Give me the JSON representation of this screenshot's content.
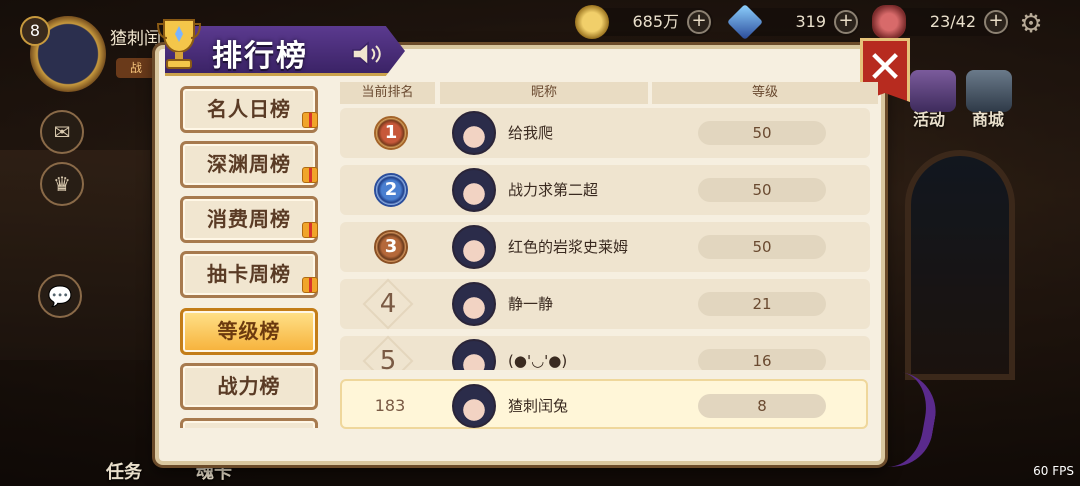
{
  "topbar": {
    "player_level": "8",
    "player_name": "猹刺闰",
    "player_tag": "战",
    "coins": "685万",
    "gems": "319",
    "stamina": "23/42",
    "fps": "60 FPS"
  },
  "right_menu": {
    "activity_label": "活动",
    "shop_label": "商城"
  },
  "bottom_menu": {
    "task_label": "任务",
    "soul_label": "魂卡"
  },
  "panel": {
    "title": "排行榜",
    "tabs": [
      {
        "label": "名人日榜",
        "active": false,
        "gift": true
      },
      {
        "label": "深渊周榜",
        "active": false,
        "gift": true
      },
      {
        "label": "消费周榜",
        "active": false,
        "gift": true
      },
      {
        "label": "抽卡周榜",
        "active": false,
        "gift": true
      },
      {
        "label": "等级榜",
        "active": true,
        "gift": false
      },
      {
        "label": "战力榜",
        "active": false,
        "gift": false
      }
    ],
    "columns": {
      "rank": "当前排名",
      "name": "昵称",
      "level": "等级"
    },
    "rows": [
      {
        "rank": "1",
        "medal": "gold",
        "name": "给我爬",
        "level": "50"
      },
      {
        "rank": "2",
        "medal": "silver",
        "name": "战力求第二超",
        "level": "50"
      },
      {
        "rank": "3",
        "medal": "bronze",
        "name": "红色的岩浆史莱姆",
        "level": "50"
      },
      {
        "rank": "4",
        "medal": "none",
        "name": "静一静",
        "level": "21"
      },
      {
        "rank": "5",
        "medal": "none",
        "name": "(●'◡'●)",
        "level": "16"
      }
    ],
    "my_row": {
      "rank": "183",
      "name": "猹刺闰兔",
      "level": "8"
    }
  }
}
